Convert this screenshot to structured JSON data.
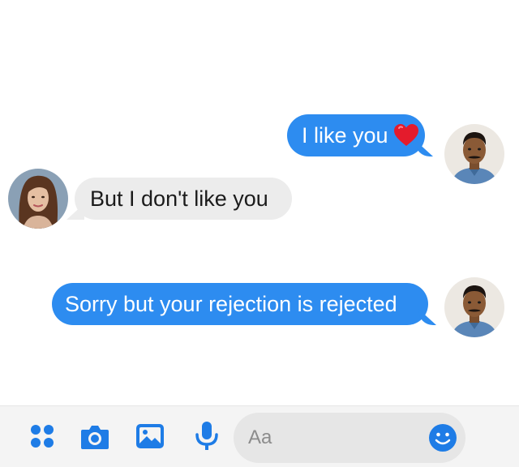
{
  "conversation": {
    "messages": [
      {
        "sender": "me",
        "text": "I like you",
        "emoji": "red-heart"
      },
      {
        "sender": "contact",
        "text": "But I don't like you"
      },
      {
        "sender": "me",
        "text": "Sorry but your rejection is rejected"
      }
    ]
  },
  "composer": {
    "placeholder": "Aa",
    "tools": [
      "more-icon",
      "camera-icon",
      "photo-icon",
      "microphone-icon"
    ],
    "emoji_icon": "smiley-icon"
  },
  "colors": {
    "outgoing_bubble": "#2d8cf0",
    "incoming_bubble": "#ececec",
    "accent": "#1e7ce6",
    "heart": "#e41b2c"
  }
}
